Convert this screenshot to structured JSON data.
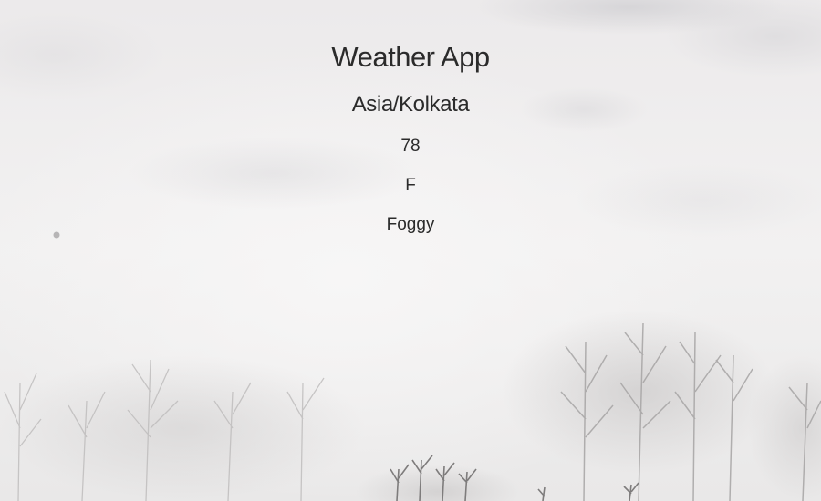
{
  "app": {
    "title": "Weather App"
  },
  "location": {
    "timezone": "Asia/Kolkata"
  },
  "weather": {
    "temperature": "78",
    "unit": "F",
    "summary": "Foggy"
  },
  "background": {
    "description_icon": "foggy-forest-background",
    "colors": {
      "fog": "#efeeef",
      "trees": "#9a9a9a"
    }
  }
}
